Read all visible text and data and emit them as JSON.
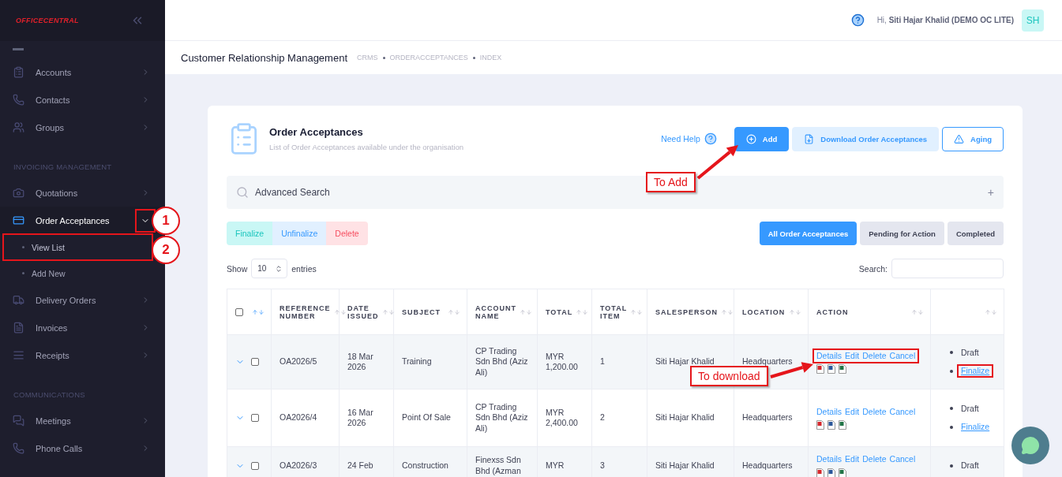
{
  "sidebar": {
    "logo": "OFFICECENTRAL",
    "items": [
      {
        "kind": "item",
        "label": "Accounts",
        "active": false,
        "expanded": false
      },
      {
        "kind": "item",
        "label": "Contacts",
        "active": false,
        "expanded": false
      },
      {
        "kind": "item",
        "label": "Groups",
        "active": false,
        "expanded": false
      },
      {
        "kind": "section",
        "label": "INVOICING MANAGEMENT"
      },
      {
        "kind": "item",
        "label": "Quotations",
        "active": false,
        "expanded": false
      },
      {
        "kind": "item",
        "label": "Order Acceptances",
        "active": true,
        "expanded": true,
        "toggle_framed": true,
        "children": [
          {
            "label": "View List",
            "selected": true,
            "framed": true
          },
          {
            "label": "Add New",
            "selected": false,
            "framed": false
          }
        ]
      },
      {
        "kind": "item",
        "label": "Delivery Orders",
        "active": false,
        "expanded": false
      },
      {
        "kind": "item",
        "label": "Invoices",
        "active": false,
        "expanded": false
      },
      {
        "kind": "item",
        "label": "Receipts",
        "active": false,
        "expanded": false
      },
      {
        "kind": "section",
        "label": "COMMUNICATIONS"
      },
      {
        "kind": "item",
        "label": "Meetings",
        "active": false,
        "expanded": false
      },
      {
        "kind": "item",
        "label": "Phone Calls",
        "active": false,
        "expanded": false
      }
    ]
  },
  "header": {
    "greeting": "Hi,",
    "user": "Siti Hajar Khalid (DEMO OC LITE)",
    "avatar": "SH"
  },
  "breadcrumb": {
    "title": "Customer Relationship Management",
    "crumbs": [
      "CRMS",
      "ORDERACCEPTANCES",
      "INDEX"
    ]
  },
  "card": {
    "title": "Order Acceptances",
    "subtitle": "List of Order Acceptances available under the organisation",
    "help": "Need Help",
    "buttons": [
      {
        "label": "Add",
        "kind": "primary"
      },
      {
        "label": "Download Order Acceptances",
        "kind": "light"
      },
      {
        "label": "Aging",
        "kind": "outline"
      }
    ],
    "advanced_search": {
      "label": "Advanced Search",
      "toggle": "+"
    },
    "bulk_actions": [
      {
        "label": "Finalize",
        "kind": "success"
      },
      {
        "label": "Unfinalize",
        "kind": "info"
      },
      {
        "label": "Delete",
        "kind": "danger"
      }
    ],
    "filters": [
      {
        "label": "All Order Acceptances",
        "selected": true
      },
      {
        "label": "Pending for Action",
        "selected": false
      },
      {
        "label": "Completed",
        "selected": false
      }
    ],
    "length": {
      "before": "Show",
      "value": "10",
      "after": "entries"
    },
    "search": {
      "label": "Search:"
    },
    "table": {
      "select_column": {
        "checked": false,
        "sorted": true
      },
      "columns": [
        {
          "label": "REFERENCE NUMBER",
          "sorted": false
        },
        {
          "label": "DATE ISSUED",
          "sorted": false
        },
        {
          "label": "SUBJECT",
          "sorted": false
        },
        {
          "label": "ACCOUNT NAME",
          "sorted": false
        },
        {
          "label": "TOTAL",
          "sorted": false
        },
        {
          "label": "TOTAL ITEM",
          "sorted": false
        },
        {
          "label": "SALESPERSON",
          "sorted": false
        },
        {
          "label": "LOCATION",
          "sorted": false
        },
        {
          "label": "ACTION",
          "sorted": false
        },
        {
          "sorted": false
        }
      ],
      "rows": [
        {
          "highlighted": true,
          "checked": false,
          "cells": [
            "OA2026/5",
            "18 Mar 2026",
            "Training",
            "CP Trading Sdn Bhd (Aziz Ali)",
            "MYR 1,200.00",
            "1",
            "Siti Hajar Khalid",
            "Headquarters"
          ],
          "actions": [
            "Details",
            "Edit",
            "Delete",
            "Cancel"
          ],
          "actions_framed": true,
          "status": [
            {
              "label": "Draft",
              "link": false,
              "framed": false
            },
            {
              "label": "Finalize",
              "link": true,
              "framed": true
            }
          ]
        },
        {
          "highlighted": false,
          "checked": false,
          "cells": [
            "OA2026/4",
            "16 Mar 2026",
            "Point Of Sale",
            "CP Trading Sdn Bhd (Aziz Ali)",
            "MYR 2,400.00",
            "2",
            "Siti Hajar Khalid",
            "Headquarters"
          ],
          "actions": [
            "Details",
            "Edit",
            "Delete",
            "Cancel"
          ],
          "actions_framed": false,
          "status": [
            {
              "label": "Draft",
              "link": false,
              "framed": false
            },
            {
              "label": "Finalize",
              "link": true,
              "framed": false
            }
          ]
        },
        {
          "highlighted": true,
          "checked": false,
          "cells": [
            "OA2026/3",
            "24 Feb",
            "Construction",
            "Finexss Sdn Bhd (Azman",
            "MYR",
            "3",
            "Siti Hajar Khalid",
            "Headquarters"
          ],
          "actions": [
            "Details",
            "Edit",
            "Delete",
            "Cancel"
          ],
          "actions_framed": false,
          "status": [
            {
              "label": "Draft",
              "link": false,
              "framed": false
            }
          ]
        }
      ]
    }
  },
  "annotations": [
    {
      "kind": "badge",
      "label": "1"
    },
    {
      "kind": "badge",
      "label": "2"
    },
    {
      "kind": "callout",
      "label": "To Add"
    },
    {
      "kind": "callout",
      "label": "To download"
    }
  ]
}
